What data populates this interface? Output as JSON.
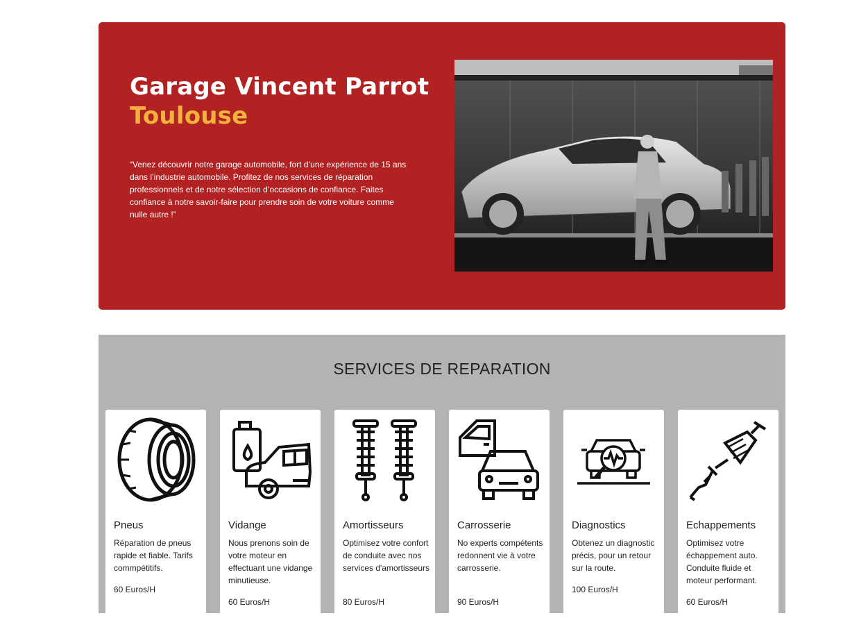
{
  "hero": {
    "title": "Garage Vincent Parrot",
    "city": "Toulouse",
    "text": "“Venez découvrir notre garage automobile, fort d’une expérience de 15 ans dans l’industrie automobile. Profitez de nos services de réparation professionnels et de notre sélection d’occasions de confiance. Faites confiance à notre savoir-faire pour prendre soin de votre voiture comme nulle autre !”",
    "photo_icon": "car-showroom-photo"
  },
  "colors": {
    "hero_bg": "#b22222",
    "accent": "#f0b23c",
    "services_bg": "#b3b3b3"
  },
  "services": {
    "title": "SERVICES DE REPARATION",
    "items": [
      {
        "icon": "tire-icon",
        "title": "Pneus",
        "desc": "Réparation de pneus rapide et fiable. Tarifs commpétitifs.",
        "price": "60 Euros/H"
      },
      {
        "icon": "oil-change-icon",
        "title": "Vidange",
        "desc": "Nous prenons soin de votre moteur en effectuant une vidange minutieuse.",
        "price": "60 Euros/H"
      },
      {
        "icon": "shock-absorber-icon",
        "title": "Amortisseurs",
        "desc": "Optimisez votre confort de conduite avec nos services d'amortisseurs",
        "price": "80 Euros/H"
      },
      {
        "icon": "car-body-icon",
        "title": "Carrosserie",
        "desc": "No experts compétents redonnent vie à votre carrosserie.",
        "price": "90 Euros/H"
      },
      {
        "icon": "diagnostics-icon",
        "title": "Diagnostics",
        "desc": "Obtenez un diagnostic précis, pour un retour sur la route.",
        "price": "100 Euros/H"
      },
      {
        "icon": "exhaust-icon",
        "title": "Echappements",
        "desc": "Optimisez votre échappement auto. Conduite fluide et moteur performant.",
        "price": "60 Euros/H"
      }
    ]
  }
}
